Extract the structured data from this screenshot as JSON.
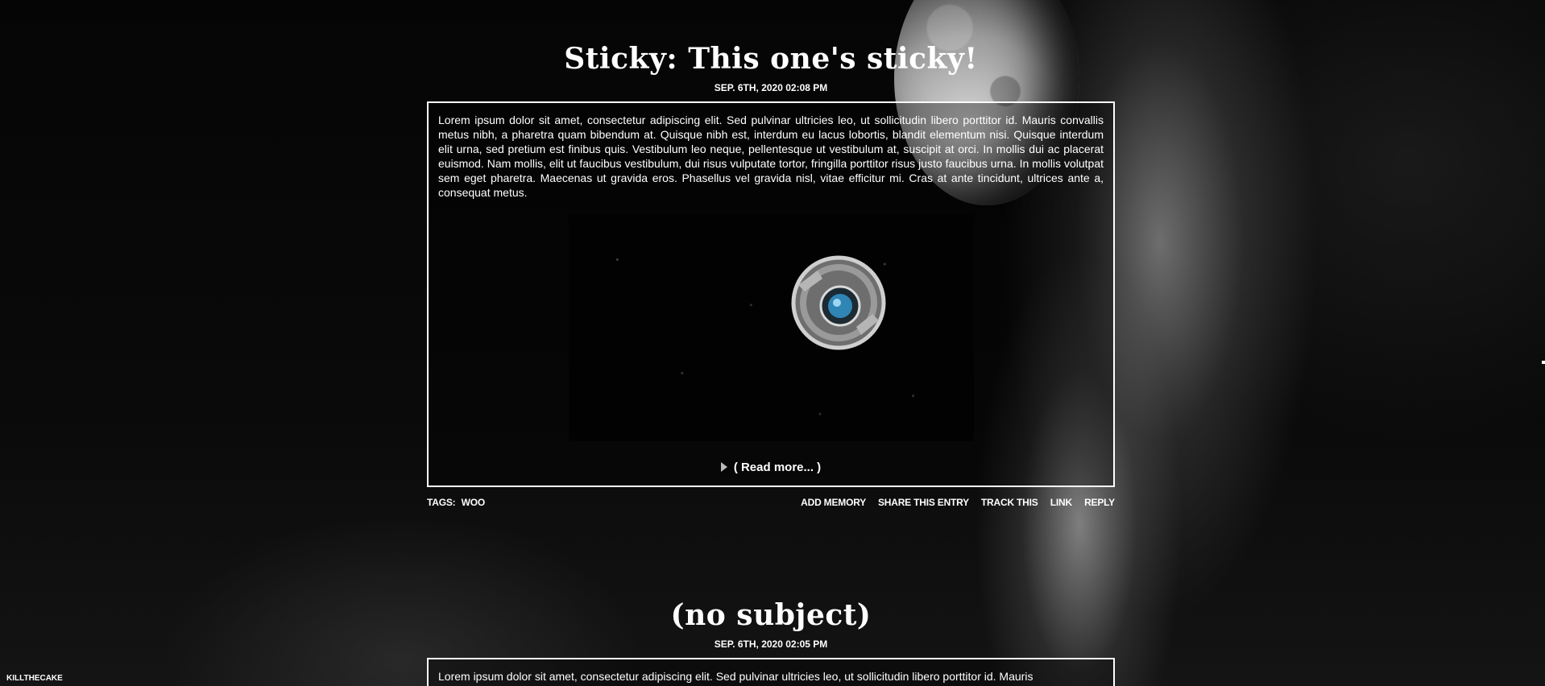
{
  "site": {
    "name": "KILLTHECAKE"
  },
  "entries": [
    {
      "title": "Sticky: This one's sticky!",
      "date": "SEP. 6TH, 2020 02:08 PM",
      "body": "Lorem ipsum dolor sit amet, consectetur adipiscing elit. Sed pulvinar ultricies leo, ut sollicitudin libero porttitor id. Mauris convallis metus nibh, a pharetra quam bibendum at. Quisque nibh est, interdum eu lacus lobortis, blandit elementum nisi. Quisque interdum elit urna, sed pretium est finibus quis. Vestibulum leo neque, pellentesque ut vestibulum at, suscipit at orci. In mollis dui ac placerat euismod. Nam mollis, elit ut faucibus vestibulum, dui risus vulputate tortor, fringilla porttitor risus justo faucibus urna. In mollis volutpat sem eget pharetra. Maecenas ut gravida eros. Phasellus vel gravida nisl, vitae efficitur mi. Cras at ante tincidunt, ultrices ante a, consequat metus.",
      "read_more": "( Read more... )",
      "tags_label": "TAGS:",
      "tags": "WOO",
      "actions": {
        "add_memory": "ADD MEMORY",
        "share": "SHARE THIS ENTRY",
        "track": "TRACK THIS",
        "link": "LINK",
        "reply": "REPLY"
      }
    },
    {
      "title": "(no subject)",
      "date": "SEP. 6TH, 2020 02:05 PM",
      "body": "Lorem ipsum dolor sit amet, consectetur adipiscing elit. Sed pulvinar ultricies leo, ut sollicitudin libero porttitor id. Mauris"
    }
  ],
  "icons": {
    "read_more": "triangle-right-icon",
    "media": "space-core-image"
  }
}
